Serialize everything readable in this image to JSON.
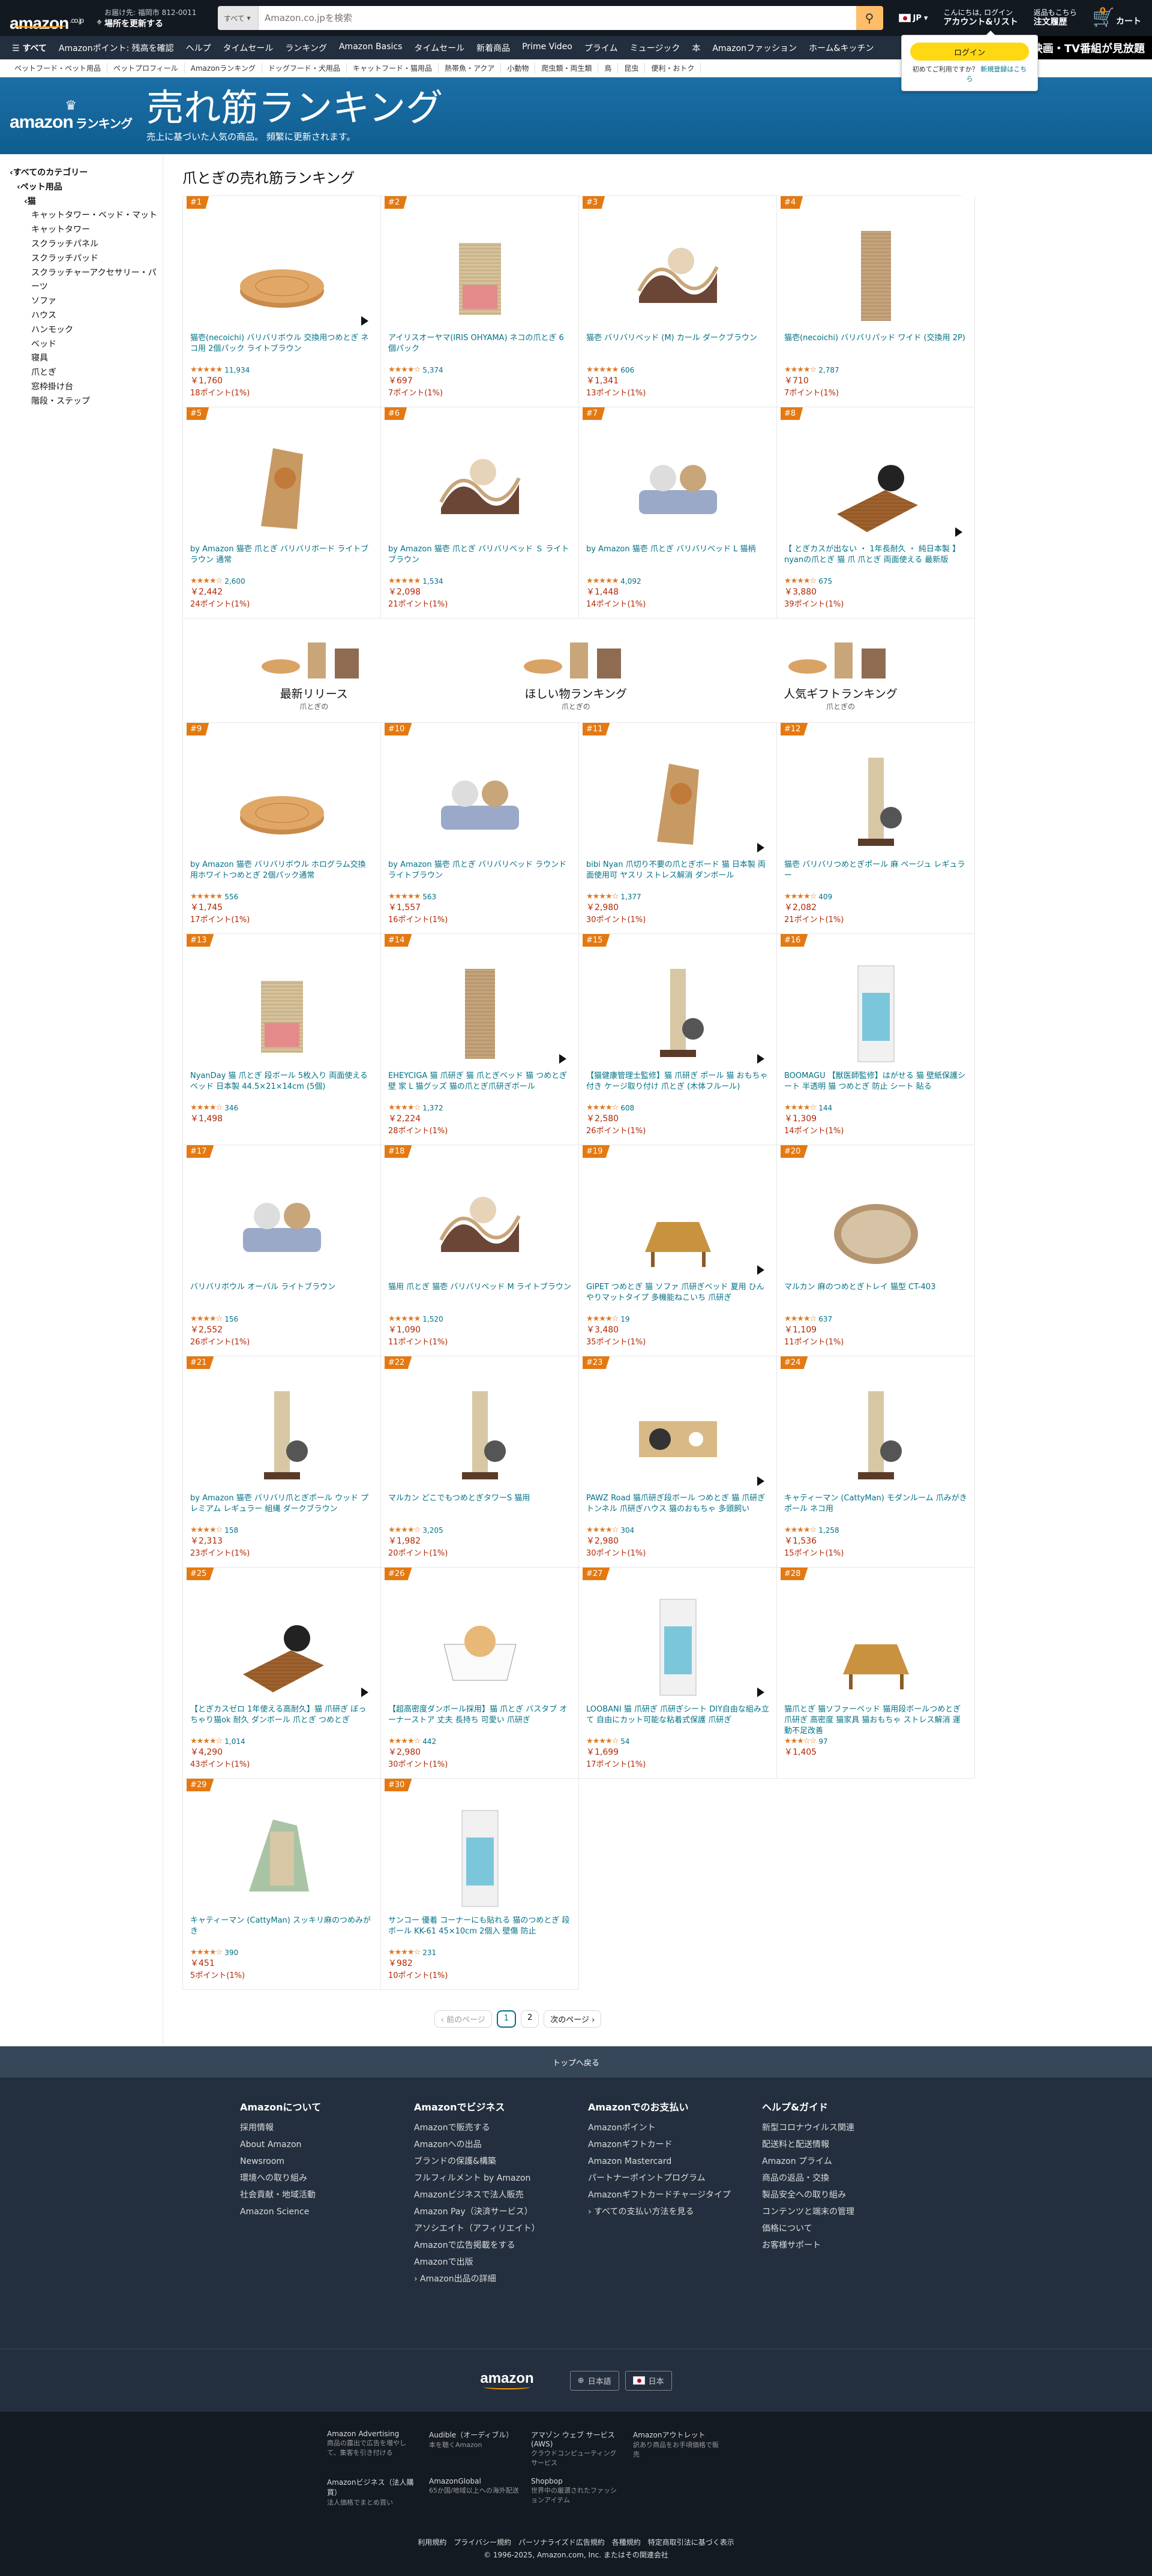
{
  "header": {
    "logo": "amazon",
    "logo_suffix": ".co.jp",
    "deliver_line1": "お届け先: 福岡市 812-0011",
    "deliver_line2": "場所を更新する",
    "search_category": "すべて",
    "search_placeholder": "Amazon.co.jpを検索",
    "lang": "JP",
    "account_line1": "こんにちは, ログイン",
    "account_line2": "アカウント&リスト",
    "orders_line1": "返品もこちら",
    "orders_line2": "注文履歴",
    "cart_count": "0",
    "cart_label": "カート"
  },
  "flyout": {
    "login": "ログイン",
    "new_text": "初めてご利用ですか？",
    "new_link": "新規登録はこちら"
  },
  "nav": {
    "all": "すべて",
    "items": [
      "Amazonポイント: 残高を確認",
      "ヘルプ",
      "タイムセール",
      "ランキング",
      "Amazon Basics",
      "タイムセール",
      "新着商品",
      "Prime Video",
      "プライム",
      "ミュージック",
      "本",
      "Amazonファッション",
      "ホーム&キッチン"
    ],
    "promo": "映画・TV番組が見放題"
  },
  "subnav": [
    "ペットフード・ペット用品",
    "ペットプロフィール",
    "Amazonランキング",
    "ドッグフード・犬用品",
    "キャットフード・猫用品",
    "熱帯魚・アクア",
    "小動物",
    "爬虫類・両生類",
    "鳥",
    "昆虫",
    "便利・おトク"
  ],
  "banner": {
    "logo": "amazon",
    "logo_sub": "ランキング",
    "title": "売れ筋ランキング",
    "subtitle": "売上に基づいた人気の商品。 頻繁に更新されます。"
  },
  "sidebar": {
    "items": [
      {
        "label": "‹すべてのカテゴリー",
        "level": 0
      },
      {
        "label": "‹ペット用品",
        "level": 1
      },
      {
        "label": "‹猫",
        "level": 2
      },
      {
        "label": "キャットタワー・ベッド・マット",
        "level": 3
      },
      {
        "label": "キャットタワー",
        "level": 3
      },
      {
        "label": "スクラッチパネル",
        "level": 3
      },
      {
        "label": "スクラッチパッド",
        "level": 3
      },
      {
        "label": "スクラッチャーアクセサリー・パーツ",
        "level": 3
      },
      {
        "label": "ソファ",
        "level": 3
      },
      {
        "label": "ハウス",
        "level": 3
      },
      {
        "label": "ハンモック",
        "level": 3
      },
      {
        "label": "ベッド",
        "level": 3
      },
      {
        "label": "寝具",
        "level": 3
      },
      {
        "label": "爪とぎ",
        "level": 3
      },
      {
        "label": "窓枠掛け台",
        "level": 3
      },
      {
        "label": "階段・ステップ",
        "level": 3
      }
    ]
  },
  "page_title": "爪とぎの売れ筋ランキング",
  "products": [
    {
      "rank": "#1",
      "title": "猫壱(necoichi) バリバリボウル 交換用つめとぎ ネコ用 2個パック ライトブラウン",
      "stars": "★★★★★",
      "reviews": "11,934",
      "price": "￥1,760",
      "points": "18ポイント(1%)",
      "video": true,
      "kind": "disc"
    },
    {
      "rank": "#2",
      "title": "アイリスオーヤマ(IRIS OHYAMA) ネコの爪とぎ 6個パック",
      "stars": "★★★★☆",
      "reviews": "5,374",
      "price": "￥697",
      "points": "7ポイント(1%)",
      "video": false,
      "kind": "box"
    },
    {
      "rank": "#3",
      "title": "猫壱 バリバリベッド (M) カール ダークブラウン",
      "stars": "★★★★★",
      "reviews": "606",
      "price": "￥1,341",
      "points": "13ポイント(1%)",
      "video": false,
      "kind": "wave"
    },
    {
      "rank": "#4",
      "title": "猫壱(necoichi) バリバリパッド ワイド (交換用 2P)",
      "stars": "★★★★☆",
      "reviews": "2,787",
      "price": "￥710",
      "points": "7ポイント(1%)",
      "video": false,
      "kind": "pad"
    },
    {
      "rank": "#5",
      "title": "by Amazon 猫壱 爪とぎ バリバリボード ライトブラウン 通常",
      "stars": "★★★★☆",
      "reviews": "2,600",
      "price": "￥2,442",
      "points": "24ポイント(1%)",
      "video": false,
      "kind": "board"
    },
    {
      "rank": "#6",
      "title": "by Amazon 猫壱 爪とぎ バリバリベッド Ｓ ライトブラウン",
      "stars": "★★★★★",
      "reviews": "1,534",
      "price": "￥2,098",
      "points": "21ポイント(1%)",
      "video": false,
      "kind": "wave"
    },
    {
      "rank": "#7",
      "title": "by Amazon 猫壱 爪とぎ バリバリベッド L 猫柄",
      "stars": "★★★★★",
      "reviews": "4,092",
      "price": "￥1,448",
      "points": "14ポイント(1%)",
      "video": false,
      "kind": "bed"
    },
    {
      "rank": "#8",
      "title": "【 とぎカスが出ない ・ 1年長耐久 ・ 純日本製 】nyanの爪とぎ 猫 爪 爪とぎ 両面使える 最新版",
      "stars": "★★★★☆",
      "reviews": "675",
      "price": "￥3,880",
      "points": "39ポイント(1%)",
      "video": true,
      "kind": "mat"
    },
    {
      "rank": "#9",
      "title": "by Amazon 猫壱 バリバリボウル ホログラム交換用ホワイトつめとぎ 2個パック通常",
      "stars": "★★★★★",
      "reviews": "556",
      "price": "￥1,745",
      "points": "17ポイント(1%)",
      "video": false,
      "kind": "disc"
    },
    {
      "rank": "#10",
      "title": "by Amazon 猫壱 爪とぎ バリバリベッド ラウンド ライトブラウン",
      "stars": "★★★★★",
      "reviews": "563",
      "price": "￥1,557",
      "points": "16ポイント(1%)",
      "video": false,
      "kind": "bed"
    },
    {
      "rank": "#11",
      "title": "bibi Nyan 爪切り不要の爪とぎボード 猫 日本製 両面使用可 ヤスリ ストレス解消 ダンボール",
      "stars": "★★★★☆",
      "reviews": "1,377",
      "price": "￥2,980",
      "points": "30ポイント(1%)",
      "video": true,
      "kind": "board"
    },
    {
      "rank": "#12",
      "title": "猫壱 バリバリつめとぎポール 麻 ベージュ レギュラー",
      "stars": "★★★★☆",
      "reviews": "409",
      "price": "￥2,082",
      "points": "21ポイント(1%)",
      "video": false,
      "kind": "pole"
    },
    {
      "rank": "#13",
      "title": "NyanDay 猫 爪とぎ 段ボール 5枚入り 両面使える ベッド 日本製 44.5×21×14cm (5個)",
      "stars": "★★★★☆",
      "reviews": "346",
      "price": "￥1,498",
      "points": "",
      "video": false,
      "kind": "box"
    },
    {
      "rank": "#14",
      "title": "EHEYCIGA 猫 爪研ぎ 猫 爪とぎベッド 猫 つめとぎ 壁 家 L 猫グッズ 猫の爪とぎ爪研ぎボール",
      "stars": "★★★★☆",
      "reviews": "1,372",
      "price": "￥2,224",
      "points": "28ポイント(1%)",
      "video": true,
      "kind": "pad"
    },
    {
      "rank": "#15",
      "title": "【猫健康管理士監修】猫 爪研ぎ ポール 猫 おもちゃ 付き ケージ取り付け 爪とぎ (木体フルール)",
      "stars": "★★★★☆",
      "reviews": "608",
      "price": "￥2,580",
      "points": "26ポイント(1%)",
      "video": true,
      "kind": "pole"
    },
    {
      "rank": "#16",
      "title": "BOOMAGU 【獣医師監修】はがせる 猫 壁紙保護シート 半透明 猫 つめとぎ 防止 シート 貼る",
      "stars": "★★★★☆",
      "reviews": "144",
      "price": "￥1,309",
      "points": "14ポイント(1%)",
      "video": false,
      "kind": "sheet"
    },
    {
      "rank": "#17",
      "title": "バリバリボウル オーバル ライトブラウン",
      "stars": "★★★★☆",
      "reviews": "156",
      "price": "￥2,552",
      "points": "26ポイント(1%)",
      "video": false,
      "kind": "bed"
    },
    {
      "rank": "#18",
      "title": "猫用 爪とぎ 猫壱 バリバリベッド M ライトブラウン",
      "stars": "★★★★★",
      "reviews": "1,520",
      "price": "￥1,090",
      "points": "11ポイント(1%)",
      "video": false,
      "kind": "wave"
    },
    {
      "rank": "#19",
      "title": "GIPET つめとぎ 猫 ソファ 爪研ぎベッド 夏用 ひんやりマットタイプ 多機能ねこいち 爪研ぎ",
      "stars": "★★★★☆",
      "reviews": "19",
      "price": "￥3,480",
      "points": "35ポイント(1%)",
      "video": true,
      "kind": "sofa"
    },
    {
      "rank": "#20",
      "title": "マルカン 麻のつめとぎトレイ 猫型 CT-403",
      "stars": "★★★★☆",
      "reviews": "637",
      "price": "￥1,109",
      "points": "11ポイント(1%)",
      "video": false,
      "kind": "tray"
    },
    {
      "rank": "#21",
      "title": "by Amazon 猫壱 バリバリ爪とぎポール ウッド プレミアム レギュラー 組縄 ダークブラウン",
      "stars": "★★★★☆",
      "reviews": "158",
      "price": "￥2,313",
      "points": "23ポイント(1%)",
      "video": false,
      "kind": "pole"
    },
    {
      "rank": "#22",
      "title": "マルカン どこでもつめとぎタワーS 猫用",
      "stars": "★★★★☆",
      "reviews": "3,205",
      "price": "￥1,982",
      "points": "20ポイント(1%)",
      "video": false,
      "kind": "pole"
    },
    {
      "rank": "#23",
      "title": "PAWZ Road 猫爪研ぎ段ボール つめとぎ 猫 爪研ぎ トンネル 爪研ぎハウス 猫のおもちゃ 多頭飼い",
      "stars": "★★★★☆",
      "reviews": "304",
      "price": "￥2,980",
      "points": "30ポイント(1%)",
      "video": true,
      "kind": "tunnel"
    },
    {
      "rank": "#24",
      "title": "キャティーマン (CattyMan) モダンルーム 爪みがきポール ネコ用",
      "stars": "★★★★☆",
      "reviews": "1,258",
      "price": "￥1,536",
      "points": "15ポイント(1%)",
      "video": false,
      "kind": "pole"
    },
    {
      "rank": "#25",
      "title": "【とぎカスゼロ 1年使える高耐久】猫 爪研ぎ ぼっちゃり猫ok 耐久 ダンボール 爪とぎ つめとぎ",
      "stars": "★★★★☆",
      "reviews": "1,014",
      "price": "￥4,290",
      "points": "43ポイント(1%)",
      "video": true,
      "kind": "mat"
    },
    {
      "rank": "#26",
      "title": "【超高密度ダンボール採用】猫 爪とぎ バスタブ オーナーストア 丈夫 長持ち 可愛い 爪研ぎ",
      "stars": "★★★★☆",
      "reviews": "442",
      "price": "￥2,980",
      "points": "30ポイント(1%)",
      "video": false,
      "kind": "tub"
    },
    {
      "rank": "#27",
      "title": "LOOBANI 猫 爪研ぎ 爪研ぎシート DIY自由な組み立て 自由にカット可能な粘着式保護 爪研ぎ",
      "stars": "★★★★☆",
      "reviews": "54",
      "price": "￥1,699",
      "points": "17ポイント(1%)",
      "video": true,
      "kind": "sheet"
    },
    {
      "rank": "#28",
      "title": "猫爪とぎ 猫ソファーベッド 猫用段ボールつめとぎ 爪研ぎ 高密度 猫家具 猫おもちゃ ストレス解消 運動不足改善",
      "stars": "★★★☆☆",
      "reviews": "97",
      "price": "￥1,405",
      "points": "",
      "video": false,
      "kind": "sofa"
    },
    {
      "rank": "#29",
      "title": "キャティーマン (CattyMan) スッキリ麻のつめみがき",
      "stars": "★★★★☆",
      "reviews": "390",
      "price": "￥451",
      "points": "5ポイント(1%)",
      "video": false,
      "kind": "slope"
    },
    {
      "rank": "#30",
      "title": "サンコー 優着 コーナーにも貼れる 猫のつめとぎ 段ボール KK-61 45×10cm 2個入 壁傷 防止",
      "stars": "★★★★☆",
      "reviews": "231",
      "price": "￥982",
      "points": "10ポイント(1%)",
      "video": false,
      "kind": "sheet"
    }
  ],
  "recommend": [
    {
      "title": "最新リリース",
      "sub": "爪とぎの"
    },
    {
      "title": "ほしい物ランキング",
      "sub": "爪とぎの"
    },
    {
      "title": "人気ギフトランキング",
      "sub": "爪とぎの"
    }
  ],
  "pager": {
    "prev": "‹ 前のページ",
    "pages": [
      "1",
      "2"
    ],
    "next": "次のページ ›"
  },
  "footer": {
    "to_top": "トップへ戻る",
    "cols": [
      {
        "title": "Amazonについて",
        "links": [
          "採用情報",
          "About Amazon",
          "Newsroom",
          "環境への取り組み",
          "社会貢献・地域活動",
          "Amazon Science"
        ]
      },
      {
        "title": "Amazonでビジネス",
        "links": [
          "Amazonで販売する",
          "Amazonへの出品",
          "ブランドの保護&構築",
          "フルフィルメント by Amazon",
          "Amazonビジネスで法人販売",
          "Amazon Pay（決済サービス）",
          "アソシエイト（アフィリエイト）",
          "Amazonで広告掲載をする",
          "Amazonで出版",
          "› Amazon出品の詳細"
        ]
      },
      {
        "title": "Amazonでのお支払い",
        "links": [
          "Amazonポイント",
          "Amazonギフトカード",
          "Amazon Mastercard",
          "パートナーポイントプログラム",
          "Amazonギフトカードチャージタイプ",
          "› すべての支払い方法を見る"
        ]
      },
      {
        "title": "ヘルプ&ガイド",
        "links": [
          "新型コロナウイルス関連",
          "配送料と配送情報",
          "Amazon プライム",
          "商品の返品・交換",
          "製品安全への取り組み",
          "コンテンツと端末の管理",
          "価格について",
          "お客様サポート"
        ]
      }
    ],
    "logo": "amazon",
    "lang_btn": "日本語",
    "country_btn": "日本",
    "services": [
      {
        "t": "Amazon Advertising",
        "d": "商品の露出で広告を増やして、集客を引き付ける"
      },
      {
        "t": "Audible（オーディブル）",
        "d": "本を聴くAmazon"
      },
      {
        "t": "アマゾン ウェブ サービス(AWS)",
        "d": "クラウドコンピューティングサービス"
      },
      {
        "t": "Amazonアウトレット",
        "d": "訳あり商品をお手頃価格で販売"
      },
      {
        "t": "",
        "d": ""
      },
      {
        "t": "Amazonビジネス（法人購買）",
        "d": "法人価格でまとめ買い"
      },
      {
        "t": "AmazonGlobal",
        "d": "65か国/地域以上への海外配送"
      },
      {
        "t": "Shopbop",
        "d": "世界中の厳選されたファッションアイテム"
      },
      {
        "t": "",
        "d": ""
      },
      {
        "t": "",
        "d": ""
      }
    ],
    "legal": [
      "利用規約",
      "プライバシー規約",
      "パーソナライズド広告規約",
      "各種規約",
      "特定商取引法に基づく表示"
    ],
    "copyright": "© 1996-2025, Amazon.com, Inc. またはその関連会社"
  }
}
